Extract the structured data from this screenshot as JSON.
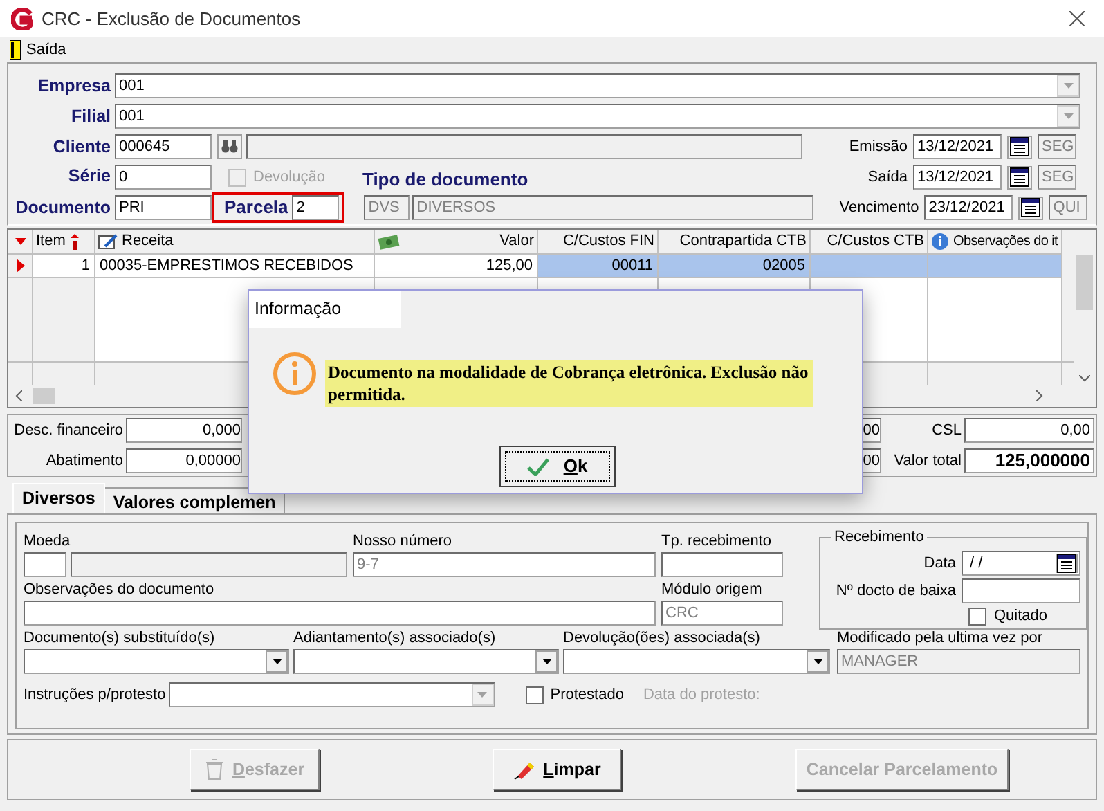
{
  "window": {
    "title": "CRC - Exclusão de Documentos"
  },
  "menu": [
    {
      "label": "Saída"
    }
  ],
  "header": {
    "empresa": {
      "label": "Empresa",
      "value": "001"
    },
    "filial": {
      "label": "Filial",
      "value": "001"
    },
    "cliente": {
      "label": "Cliente",
      "value": "000645"
    },
    "serie": {
      "label": "Série",
      "value": "0"
    },
    "devolucao": {
      "label": "Devolução",
      "checked": false,
      "disabled": true
    },
    "documento": {
      "label": "Documento",
      "value": "PRI"
    },
    "parcela": {
      "label": "Parcela",
      "value": "2"
    },
    "tipo_documento": {
      "label": "Tipo de documento",
      "code": "DVS",
      "name": "DIVERSOS"
    },
    "dates": [
      {
        "label": "Emissão",
        "value": "13/12/2021",
        "weekday": "SEG"
      },
      {
        "label": "Saída",
        "value": "13/12/2021",
        "weekday": "SEG"
      },
      {
        "label": "Vencimento",
        "value": "23/12/2021",
        "weekday": "QUI"
      }
    ]
  },
  "grid": {
    "columns": [
      "Item",
      "Receita",
      "Valor",
      "C/Custos FIN",
      "Contrapartida CTB",
      "C/Custos CTB",
      "Observações do it"
    ],
    "rows": [
      {
        "selected": true,
        "item": "1",
        "receita": "00035-EMPRESTIMOS RECEBIDOS",
        "valor": "125,00",
        "cc_fin": "00011",
        "contrapartida": "02005"
      }
    ]
  },
  "totals_left": [
    {
      "label": "Desc. financeiro",
      "value": "0,000"
    },
    {
      "label": "Abatimento",
      "value": "0,00000"
    }
  ],
  "totals_middle": [
    "00",
    "00"
  ],
  "totals_right": [
    {
      "label": "CSL",
      "value": "0,00",
      "kind": "plain"
    },
    {
      "label": "Valor total",
      "value": "125,000000",
      "kind": "total"
    }
  ],
  "tabs": [
    {
      "label": "Diversos",
      "selected": true
    },
    {
      "label": "Valores complemen",
      "selected": false
    }
  ],
  "diversos": {
    "moeda": {
      "label": "Moeda"
    },
    "nosso_numero": {
      "label": "Nosso número",
      "value": "9-7"
    },
    "tp_recebimento": {
      "label": "Tp. recebimento"
    },
    "observacoes": {
      "label": "Observações do documento"
    },
    "modulo_origem": {
      "label": "Módulo origem",
      "value": "CRC"
    },
    "dropdowns": [
      {
        "label": "Documento(s) substituído(s)"
      },
      {
        "label": "Adiantamento(s) associado(s)"
      },
      {
        "label": "Devolução(ões) associada(s)"
      }
    ],
    "modificado": {
      "label": "Modificado pela ultima vez por",
      "value": "MANAGER"
    },
    "instrucoes": {
      "label": "Instruções p/protesto"
    },
    "protestado": {
      "label": "Protestado",
      "checked": false
    },
    "data_protesto": {
      "label": "Data do protesto:",
      "disabled": true
    },
    "recebimento": {
      "title": "Recebimento",
      "data": {
        "label": "Data",
        "value": " / /"
      },
      "docto": {
        "label": "Nº docto de baixa"
      },
      "quitado": {
        "label": "Quitado",
        "checked": false
      }
    }
  },
  "buttons": [
    {
      "label": "Desfazer",
      "disabled": true,
      "kind": "undo"
    },
    {
      "label": "Limpar",
      "disabled": false,
      "kind": "clear"
    },
    {
      "label": "Cancelar Parcelamento",
      "disabled": true,
      "kind": "plain"
    }
  ],
  "dialog": {
    "title": "Informação",
    "message": "Documento na modalidade de Cobrança eletrônica. Exclusão não permitida.",
    "button": "Ok"
  }
}
